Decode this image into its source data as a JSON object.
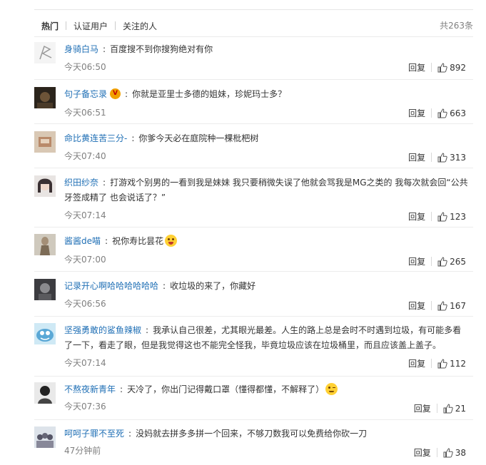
{
  "tabs": [
    {
      "label": "热门",
      "active": true
    },
    {
      "label": "认证用户",
      "active": false
    },
    {
      "label": "关注的人",
      "active": false
    }
  ],
  "total_label": "共263条",
  "reply_label": "回复",
  "comments": [
    {
      "user": "身骑白马",
      "text": "百度搜不到你搜狗绝对有你",
      "time": "今天06:50",
      "likes": "892",
      "avatar": "avatar-sketch"
    },
    {
      "user": "句子备忘录",
      "text": "你就是亚里士多德的姐妹，珍妮玛士多？",
      "time": "今天06:51",
      "likes": "663",
      "avatar": "avatar-dark",
      "badge": "verified-badge"
    },
    {
      "user": "命比黄连苦三分-",
      "text": "你爹今天必在庭院种一棵枇杷树",
      "time": "今天07:40",
      "likes": "313",
      "avatar": "avatar-photo"
    },
    {
      "user": "织田纱奈",
      "text": "打游戏个别男的一看到我是妹妹 我只要稍微失误了他就会骂我是MG之类的 我每次就会回“公共牙签成精了 也会说话了？”",
      "time": "今天07:14",
      "likes": "123",
      "avatar": "avatar-girl"
    },
    {
      "user": "酱酱de喵",
      "text": "祝你寿比昙花",
      "time": "今天07:00",
      "likes": "265",
      "avatar": "avatar-figure",
      "emoji": "tongue-emoji"
    },
    {
      "user": "记录开心啊哈哈哈哈哈哈",
      "text": "收垃圾的来了，你藏好",
      "time": "今天06:56",
      "likes": "167",
      "avatar": "avatar-portrait"
    },
    {
      "user": "坚强勇敢的鲨鱼辣椒",
      "text": "我承认自己很差，尤其眼光最差。人生的路上总是会时不时遇到垃圾，有可能多看了一下，看走了眼，但是我觉得这也不能完全怪我，毕竟垃圾应该在垃圾桶里，而且应该盖上盖子。",
      "time": "今天07:14",
      "likes": "112",
      "avatar": "avatar-cartoon"
    },
    {
      "user": "不熬夜新青年",
      "text": "天冷了，你出门记得戴口罩（懂得都懂，不解释了）",
      "time": "今天07:36",
      "likes": "21",
      "avatar": "avatar-bw",
      "emoji": "wink-emoji"
    },
    {
      "user": "呵呵子罪不至死",
      "text": "没妈就去拼多多拼一个回来，不够刀数我可以免费给你砍一刀",
      "time": "47分钟前",
      "likes": "38",
      "avatar": "avatar-group"
    }
  ],
  "colors": {
    "username": "#1f6fb5",
    "time": "#808080",
    "text": "#333333"
  }
}
